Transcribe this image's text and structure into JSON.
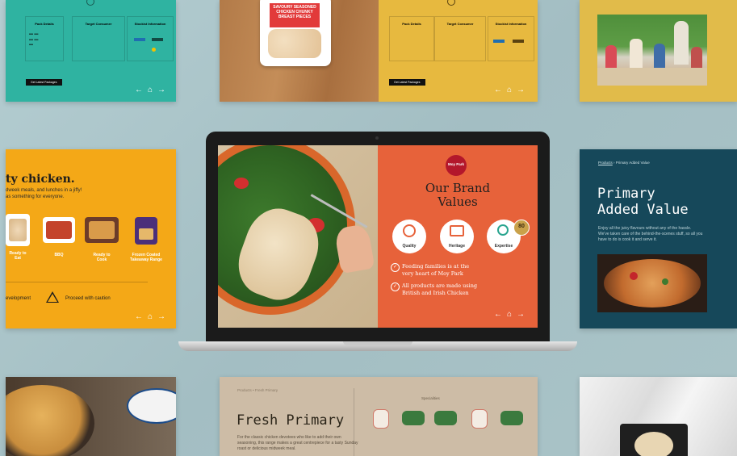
{
  "top_left_card": {
    "columns": [
      "Pack Details",
      "Target Consumer",
      "Stockist Information"
    ],
    "button": "Get Latest Packages",
    "nav": [
      "←",
      "⌂",
      "→"
    ],
    "color": "#2fb3a1"
  },
  "top_center_card": {
    "pack_text": [
      "SAVOURY SEASONED",
      "CHICKEN CHUNKY",
      "BREAST PIECES"
    ],
    "columns": [
      "Pack Details",
      "Target Consumer",
      "Stockist Information"
    ],
    "button": "Get Latest Packages",
    "nav": [
      "←",
      "⌂",
      "→"
    ],
    "color": "#e7b93f"
  },
  "left_card": {
    "title": "ty chicken.",
    "subtitle_1": "dweek meals, and lunches in a jiffy!",
    "subtitle_2": "as something for everyone.",
    "products": [
      "Ready to Eat",
      "BBQ",
      "Ready to Cook",
      "Frozen Coated Takeaway Range"
    ],
    "development": "evelopment",
    "caution": "Proceed with caution",
    "nav": [
      "←",
      "⌂",
      "→"
    ],
    "color": "#f4a817"
  },
  "laptop_screen": {
    "brand_logo": "Moy Park",
    "title_line1": "Our Brand",
    "title_line2": "Values",
    "values": [
      {
        "label": "Quality",
        "icon": "ribbon-icon"
      },
      {
        "label": "Heritage",
        "icon": "book-icon"
      },
      {
        "label": "Expertise",
        "icon": "magnifier-icon",
        "badge": "80"
      }
    ],
    "statements": [
      {
        "line1": "Feeding families is at the",
        "line2": "very heart of Moy Park"
      },
      {
        "line1": "All products are made using",
        "line2": "British and Irish Chicken"
      }
    ],
    "nav": [
      "←",
      "⌂",
      "→"
    ],
    "color": "#e7623a"
  },
  "right_card": {
    "breadcrumb_link": "Products",
    "breadcrumb_current": "Primary Added Value",
    "title_line1": "Primary",
    "title_line2": "Added Value",
    "description": "Enjoy all the juicy flavours without any of the hassle. We've taken care of the behind-the-scenes stuff, so all you have to do is cook it and serve it.",
    "color": "#16485a"
  },
  "bottom_card": {
    "breadcrumb": "Products • Fresh Primary",
    "title": "Fresh Primary",
    "description": "For the classic chicken devotees who like to add their own seasoning, this range makes a great centrepiece for a tasty Sunday roast or delicious midweek meal.",
    "section": "Specialities",
    "color": "#cdbca6"
  }
}
